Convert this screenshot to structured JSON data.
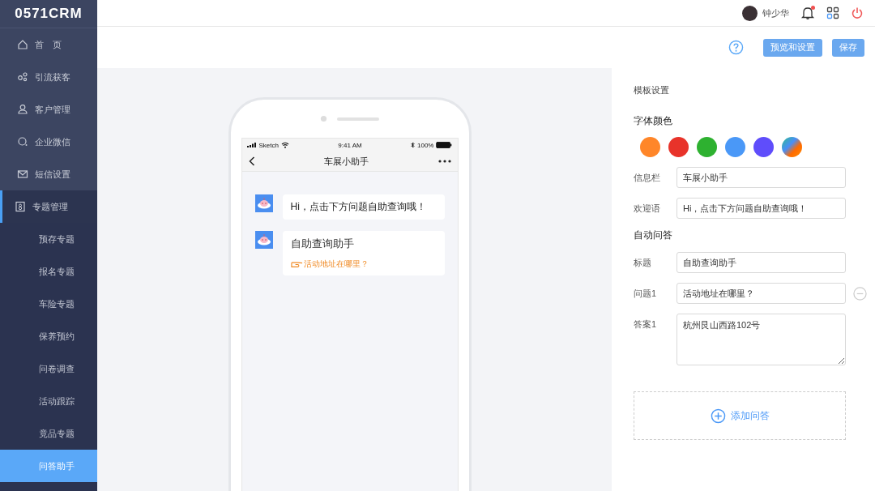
{
  "sidebar": {
    "logo": "0571CRM",
    "items": [
      {
        "label": "首　页",
        "expanded": false
      },
      {
        "label": "引流获客",
        "expanded": false
      },
      {
        "label": "客户管理",
        "expanded": false
      },
      {
        "label": "企业微信",
        "expanded": false
      },
      {
        "label": "短信设置",
        "expanded": false
      },
      {
        "label": "专题管理",
        "expanded": true,
        "children": [
          {
            "label": "预存专题",
            "selected": false
          },
          {
            "label": "报名专题",
            "selected": false
          },
          {
            "label": "车险专题",
            "selected": false
          },
          {
            "label": "保养预约",
            "selected": false
          },
          {
            "label": "问卷调查",
            "selected": false
          },
          {
            "label": "活动跟踪",
            "selected": false
          },
          {
            "label": "竟品专题",
            "selected": false
          },
          {
            "label": "问答助手",
            "selected": true
          }
        ]
      }
    ]
  },
  "header": {
    "user_name": "钟少华"
  },
  "toolbar": {
    "buttons": [
      "预览和设置",
      "保存"
    ]
  },
  "phone": {
    "status": {
      "carrier": "Sketch",
      "time": "9:41 AM",
      "battery": "100%"
    },
    "nav_title": "车展小助手",
    "messages": [
      {
        "kind": "text",
        "text": "Hi，点击下方问题自助查询哦！"
      },
      {
        "kind": "qa",
        "title": "自助查询助手",
        "questions": [
          "活动地址在哪里？"
        ]
      }
    ]
  },
  "settings": {
    "title": "模板设置",
    "font_color_label": "字体颜色",
    "font_colors": [
      {
        "kind": "solid",
        "color": "#ff8629"
      },
      {
        "kind": "solid",
        "color": "#e8332a"
      },
      {
        "kind": "solid",
        "color": "#2eb130"
      },
      {
        "kind": "solid",
        "color": "#4a98f7"
      },
      {
        "kind": "solid",
        "color": "#5f4dfb"
      },
      {
        "kind": "gradient"
      }
    ],
    "fields": [
      {
        "kind": "input",
        "label": "信息栏",
        "value": "车展小助手"
      },
      {
        "kind": "input",
        "label": "欢迎语",
        "value": "Hi，点击下方问题自助查询哦！"
      }
    ],
    "auto_qa_label": "自动问答",
    "qa_fields": [
      {
        "kind": "input",
        "label": "标题",
        "value": "自助查询助手",
        "removable": false
      },
      {
        "kind": "input",
        "label": "问题1",
        "value": "活动地址在哪里？",
        "removable": true
      },
      {
        "kind": "textarea",
        "label": "答案1",
        "value": "杭州艮山西路102号",
        "removable": false
      }
    ],
    "add_label": "添加问答"
  }
}
